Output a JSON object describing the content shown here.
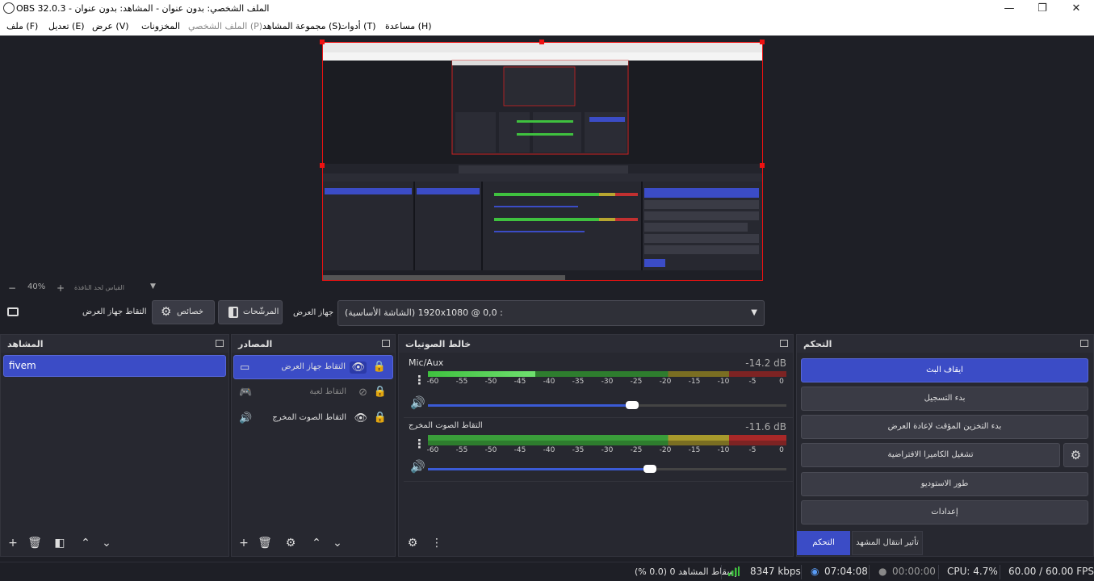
{
  "window": {
    "title": "OBS 32.0.3 - الملف الشخصي: بدون عنوان - المشاهد: بدون عنوان",
    "minimize": "—",
    "maximize": "❐",
    "close": "✕"
  },
  "menu": [
    "ملف (F)",
    "تعديل (E)",
    "عرض (V)",
    "المخزونات",
    "الملف الشخصي (P)",
    "مجموعة المشاهد (S)",
    "أدوات (T)",
    "مساعدة (H)"
  ],
  "preview": {
    "zoom": "40%",
    "zoom_minus": "−",
    "zoom_plus": "+",
    "scale_mode": "القياس لحد النافذة"
  },
  "source_bar": {
    "selected_source": "التقاط جهاز العرض",
    "properties": "خصائص",
    "filters": "المرشّحات",
    "display_label": "جهاز العرض",
    "display_value": "(الشاشة الأساسية) 1920x1080 @ 0,0 :"
  },
  "scenes": {
    "title": "المشاهد",
    "items": [
      "fivem"
    ]
  },
  "sources": {
    "title": "المصادر",
    "items": [
      {
        "label": "التقاط جهاز العرض",
        "icon": "monitor-icon",
        "visible": true,
        "selected": true
      },
      {
        "label": "التقاط لعبة",
        "icon": "gamepad-icon",
        "visible": false,
        "selected": false
      },
      {
        "label": "التقاط الصوت المخرج",
        "icon": "speaker-icon",
        "visible": true,
        "selected": false
      }
    ]
  },
  "mixer": {
    "title": "خالط الصوتيات",
    "ticks": [
      "-60",
      "-55",
      "-50",
      "-45",
      "-40",
      "-35",
      "-30",
      "-25",
      "-20",
      "-15",
      "-10",
      "-5",
      "0"
    ],
    "channels": [
      {
        "name": "Mic/Aux",
        "db": "-14.2 dB",
        "level": 0.3,
        "fader": 0.57
      },
      {
        "name": "التقاط الصوت المخرج",
        "db": "-11.6 dB",
        "level": 1.0,
        "fader": 0.62
      }
    ]
  },
  "controls": {
    "title": "التحكم",
    "stop_stream": "ايقاف البث",
    "start_recording": "بدء التسجيل",
    "replay_buffer": "بدء التخزين المؤقت لإعادة العرض",
    "virtual_camera": "تشغيل الكاميرا الافتراضية",
    "studio_mode": "طور الاستوديو",
    "settings": "إعدادات",
    "tab_controls": "التحكم",
    "tab_transitions": "تأثير انتقال المشهد"
  },
  "status": {
    "dropped": "إسقاط المشاهد 0 (0.0 %)",
    "bitrate": "8347 kbps",
    "stream_time": "07:04:08",
    "rec_time": "00:00:00",
    "cpu": "CPU: 4.7%",
    "fps": "60.00 / 60.00 FPS"
  },
  "colors": {
    "accent": "#3b4cc6",
    "meter_green": "#3fc13f",
    "meter_yellow": "#b8a630",
    "meter_red": "#c13030"
  }
}
